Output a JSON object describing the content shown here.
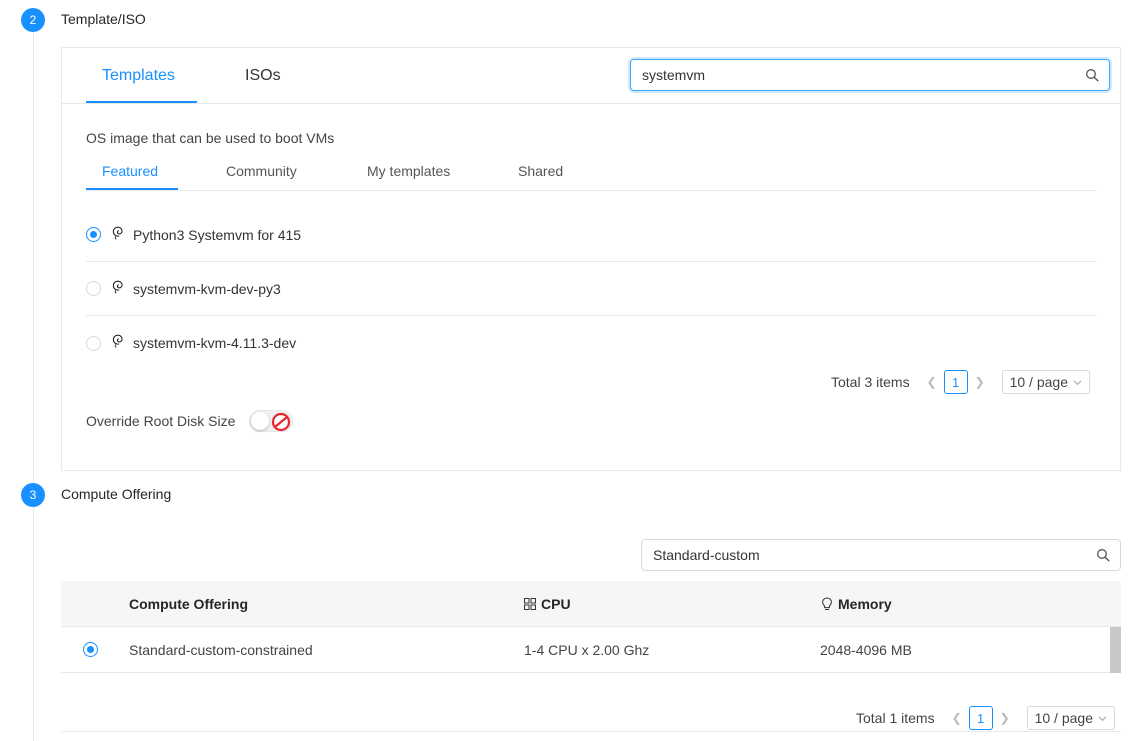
{
  "steps": [
    {
      "number": "2",
      "title": "Template/ISO"
    },
    {
      "number": "3",
      "title": "Compute Offering"
    }
  ],
  "template_card": {
    "tabs": [
      {
        "label": "Templates"
      },
      {
        "label": "ISOs"
      }
    ],
    "search": {
      "value": "systemvm",
      "placeholder": ""
    },
    "description": "OS image that can be used to boot VMs",
    "sub_tabs": [
      {
        "label": "Featured"
      },
      {
        "label": "Community"
      },
      {
        "label": "My templates"
      },
      {
        "label": "Shared"
      }
    ],
    "templates": [
      {
        "name": "Python3 Systemvm for 415",
        "selected": true,
        "icon": "debian-swirl-icon"
      },
      {
        "name": "systemvm-kvm-dev-py3",
        "selected": false,
        "icon": "debian-swirl-icon"
      },
      {
        "name": "systemvm-kvm-4.11.3-dev",
        "selected": false,
        "icon": "debian-swirl-icon"
      }
    ],
    "pagination": {
      "total": "Total 3 items",
      "page": "1",
      "page_size": "10 / page"
    },
    "override_root_disk": {
      "label": "Override Root Disk Size",
      "enabled": false
    }
  },
  "compute_offering": {
    "search": {
      "value": "Standard-custom",
      "placeholder": ""
    },
    "columns": [
      {
        "label": "Compute Offering",
        "icon": ""
      },
      {
        "label": "CPU",
        "icon": "grid-icon"
      },
      {
        "label": "Memory",
        "icon": "bulb-icon"
      }
    ],
    "rows": [
      {
        "name": "Standard-custom-constrained",
        "cpu": "1-4 CPU x 2.00 Ghz",
        "memory": "2048-4096 MB",
        "selected": true
      }
    ],
    "pagination": {
      "total": "Total 1 items",
      "page": "1",
      "page_size": "10 / page"
    }
  },
  "colors": {
    "accent": "#1890ff",
    "border": "#e8e8e8",
    "header_bg": "#f5f6f7",
    "disabled_red": "#e8262d"
  }
}
